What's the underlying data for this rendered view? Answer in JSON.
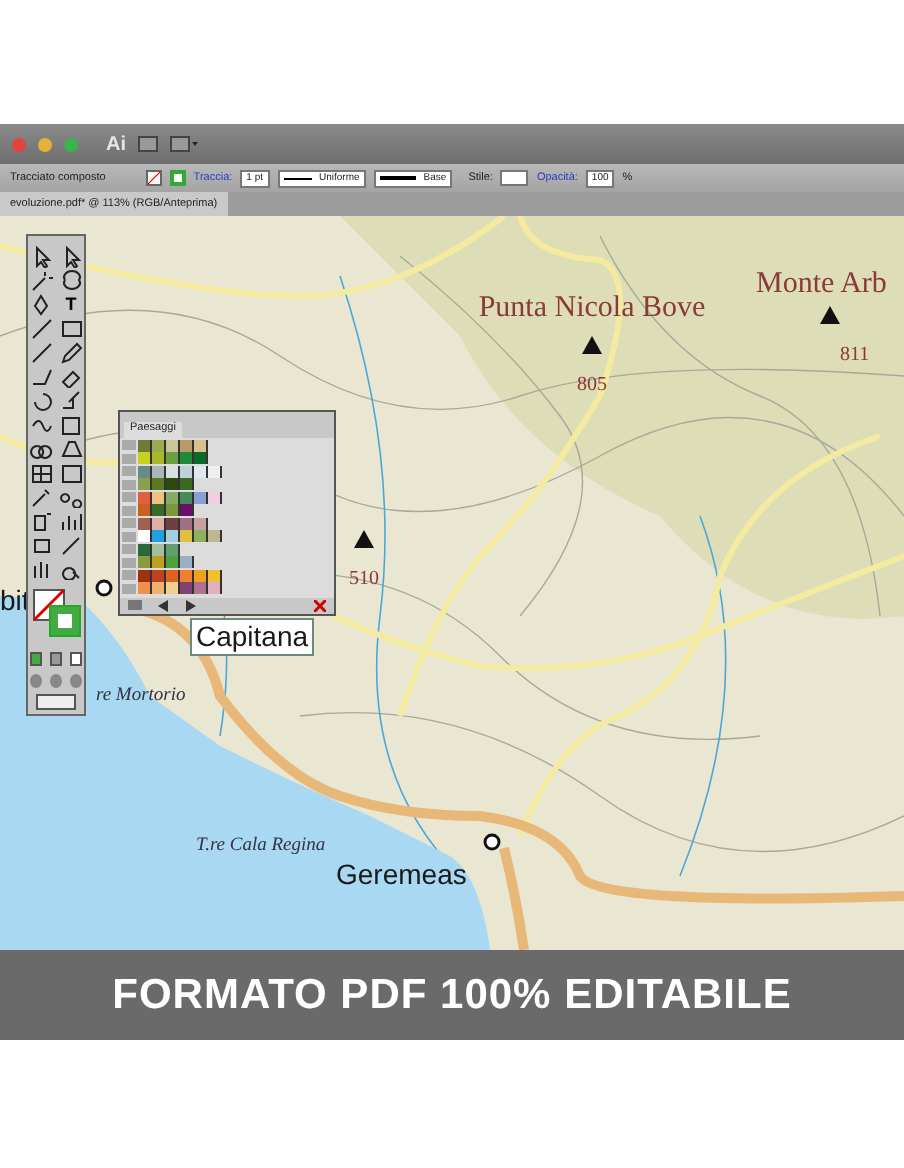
{
  "app": {
    "logo": "Ai"
  },
  "control_bar": {
    "selection": "Tracciato composto",
    "stroke_label": "Traccia:",
    "stroke_weight": "1 pt",
    "profile": "Uniforme",
    "brush": "Base",
    "style_label": "Stile:",
    "opacity_label": "Opacità:",
    "opacity": "100",
    "percent": "%"
  },
  "document_tab": {
    "title": "evoluzione.pdf* @ 113% (RGB/Anteprima)"
  },
  "toolbox": {
    "type_tool": "T"
  },
  "swatches_panel": {
    "tab": "Paesaggi",
    "rows": [
      [
        {
          "color": "#6b7b3a"
        },
        {
          "color": "#9aab52"
        },
        {
          "color": "#c9c79a"
        },
        {
          "color": "#b89a6a"
        },
        {
          "color": "#d8c090"
        }
      ],
      [
        {
          "color": "#c8d020"
        },
        {
          "color": "#a8b828"
        },
        {
          "color": "#6aa040"
        },
        {
          "color": "#1e8a3a"
        },
        {
          "color": "#0a6a2a"
        }
      ],
      [
        {
          "color": "#6a8a8a"
        },
        {
          "color": "#a8b8b8"
        },
        {
          "color": "#d8e0e0"
        },
        {
          "color": "#c0d0d8"
        },
        {
          "color": "#e0e8f0"
        },
        {
          "color": "#f0f0f0"
        }
      ],
      [
        {
          "color": "#8aa050"
        },
        {
          "color": "#5a7a20"
        },
        {
          "color": "#2a4a10"
        },
        {
          "color": "#3a6a20"
        }
      ],
      [
        {
          "color": "#e06040"
        },
        {
          "color": "#f0c080"
        },
        {
          "color": "#88a868"
        },
        {
          "color": "#4a8a5a"
        },
        {
          "color": "#8aa0d0"
        },
        {
          "color": "#f0d0e0"
        }
      ],
      [
        {
          "color": "#c86020"
        },
        {
          "color": "#3a6a2a"
        },
        {
          "color": "#7a9a3a"
        },
        {
          "color": "#6a106a"
        }
      ],
      [
        {
          "color": "#a06050"
        },
        {
          "color": "#e0b0a0"
        },
        {
          "color": "#704040"
        },
        {
          "color": "#a07080"
        },
        {
          "color": "#c8a0a0"
        }
      ],
      [
        {
          "color": "#ffffff"
        },
        {
          "color": "#20a0e0"
        },
        {
          "color": "#a0d0e0"
        },
        {
          "color": "#e0c040"
        },
        {
          "color": "#90b060"
        },
        {
          "color": "#c0b890"
        }
      ],
      [
        {
          "color": "#2a6a3a"
        },
        {
          "color": "#a0c0a0"
        },
        {
          "color": "#60a070"
        }
      ],
      [
        {
          "color": "#8a9a40"
        },
        {
          "color": "#c0a020"
        },
        {
          "color": "#50a040"
        },
        {
          "color": "#9ab0c0"
        }
      ],
      [
        {
          "color": "#a03010"
        },
        {
          "color": "#c04020"
        },
        {
          "color": "#e06020"
        },
        {
          "color": "#f08030"
        },
        {
          "color": "#f0a020"
        },
        {
          "color": "#f0c030"
        }
      ],
      [
        {
          "color": "#f09050"
        },
        {
          "color": "#f0b070"
        },
        {
          "color": "#f0d090"
        },
        {
          "color": "#804070"
        },
        {
          "color": "#b07090"
        },
        {
          "color": "#e0b0c0"
        }
      ]
    ]
  },
  "map_labels": [
    {
      "kind": "peak",
      "text": "Punta Nicola Bove"
    },
    {
      "kind": "elevation",
      "text": "805"
    },
    {
      "kind": "peak",
      "text": "Monte Arb"
    },
    {
      "kind": "elevation",
      "text": "811"
    },
    {
      "kind": "elevation",
      "text": "510"
    },
    {
      "kind": "place",
      "text": "bit"
    },
    {
      "kind": "place",
      "text": "Capitana",
      "boxed": true
    },
    {
      "kind": "tower",
      "text": "re Mortorio"
    },
    {
      "kind": "tower",
      "text": "T.re Cala Regina"
    },
    {
      "kind": "place",
      "text": "Geremeas"
    }
  ],
  "banner": {
    "text": "FORMATO PDF 100% EDITABILE"
  }
}
